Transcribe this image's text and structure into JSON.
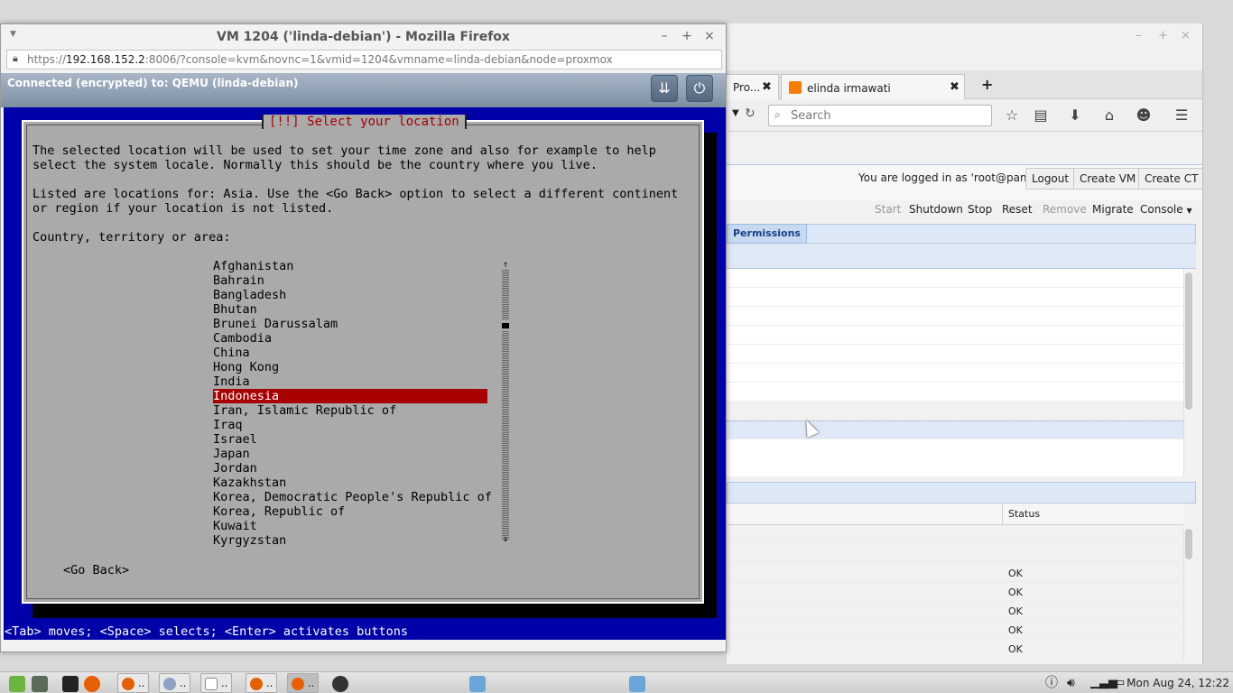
{
  "bg_browser": {
    "tabs": [
      {
        "label": "Pro..."
      },
      {
        "label": "elinda irmawati"
      }
    ],
    "search_placeholder": "Search",
    "new_tab": "+",
    "login_text": "You are logged in as 'root@pam'",
    "buttons": {
      "logout": "Logout",
      "create_vm": "Create VM",
      "create_ct": "Create CT"
    },
    "toolbar": {
      "start": "Start",
      "shutdown": "Shutdown",
      "stop": "Stop",
      "reset": "Reset",
      "remove": "Remove",
      "migrate": "Migrate",
      "console": "Console"
    },
    "permissions_tab": "Permissions",
    "status_header": "Status",
    "status_values": [
      "OK",
      "OK",
      "OK",
      "OK",
      "OK"
    ]
  },
  "vm_window": {
    "title": "VM 1204 ('linda-debian') - Mozilla Firefox",
    "url_prefix": "https://",
    "url_host": "192.168.152.2",
    "url_rest": ":8006/?console=kvm&novnc=1&vmid=1204&vmname=linda-debian&node=proxmox",
    "vnc_status": "Connected (encrypted) to: QEMU (linda-debian)"
  },
  "installer": {
    "dialog_title": "[!!] Select your location",
    "para1_line1": "The selected location will be used to set your time zone and also for example to help",
    "para1_line2": "select the system locale. Normally this should be the country where you live.",
    "para2_line1": "Listed are locations for: Asia. Use the <Go Back> option to select a different continent",
    "para2_line2": "or region if your location is not listed.",
    "prompt": "Country, territory or area:",
    "countries": [
      "Afghanistan",
      "Bahrain",
      "Bangladesh",
      "Bhutan",
      "Brunei Darussalam",
      "Cambodia",
      "China",
      "Hong Kong",
      "India",
      "Indonesia",
      "Iran, Islamic Republic of",
      "Iraq",
      "Israel",
      "Japan",
      "Jordan",
      "Kazakhstan",
      "Korea, Democratic People's Republic of",
      "Korea, Republic of",
      "Kuwait",
      "Kyrgyzstan"
    ],
    "selected": "Indonesia",
    "go_back": "<Go Back>",
    "help_line": "<Tab> moves; <Space> selects; <Enter> activates buttons"
  },
  "taskbar": {
    "task_label": "..",
    "clock": "Mon Aug 24, 12:22"
  },
  "colors": {
    "installer_bg": "#0000a8",
    "dialog_bg": "#aaaaaa",
    "selection": "#a80000",
    "title_red": "#a80000"
  }
}
